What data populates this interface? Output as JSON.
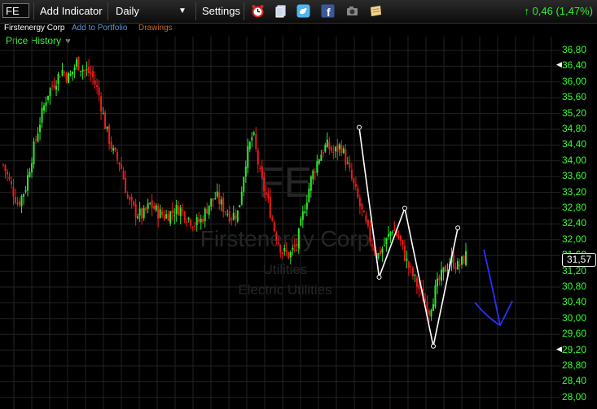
{
  "toolbar": {
    "ticker": "FE",
    "add_indicator": "Add Indicator",
    "interval": "Daily",
    "settings": "Settings",
    "change": "0,46 (1,47%)"
  },
  "subbar": {
    "company": "Firstenergy Corp",
    "add_portfolio": "Add to Portfolio",
    "drawings": "Drawings"
  },
  "panel": {
    "label": "Price History"
  },
  "watermark": {
    "ticker": "FE",
    "company": "Firstenergy Corp",
    "sector": "Utilities",
    "industry": "Electric Utilities"
  },
  "chart_data": {
    "type": "candlestick",
    "y_ticks": [
      "36,80",
      "36,40",
      "36,00",
      "35,60",
      "35,20",
      "34,80",
      "34,40",
      "34,00",
      "33,60",
      "33,20",
      "32,80",
      "32,40",
      "32,00",
      "31,60",
      "31,20",
      "30,80",
      "30,40",
      "30,00",
      "29,60",
      "29,20",
      "28,80",
      "28,40",
      "28,00"
    ],
    "ylim": [
      28.0,
      36.8
    ],
    "last_price": "31,57",
    "price_path": [
      33.9,
      33.4,
      32.9,
      33.3,
      34.2,
      35.0,
      35.7,
      36.0,
      36.3,
      36.1,
      36.5,
      36.3,
      36.2,
      35.7,
      34.8,
      34.2,
      33.9,
      33.0,
      32.7,
      32.6,
      32.9,
      32.7,
      32.6,
      32.7,
      32.8,
      32.6,
      32.4,
      32.5,
      32.9,
      33.1,
      32.8,
      32.6,
      32.7,
      34.0,
      34.7,
      33.6,
      33.0,
      32.2,
      31.7,
      31.6,
      31.9,
      32.8,
      33.6,
      34.1,
      34.4,
      34.2,
      34.4,
      33.8,
      33.2,
      32.6,
      32.0,
      31.6,
      31.9,
      32.3,
      32.0,
      31.4,
      31.0,
      30.6,
      30.2,
      30.8,
      31.2,
      31.5,
      31.3,
      31.6
    ],
    "pattern_points": [
      {
        "x": 20,
        "price": 34.85
      },
      {
        "x": 55,
        "price": 31.05
      },
      {
        "x": 100,
        "price": 32.8
      },
      {
        "x": 150,
        "price": 29.3
      },
      {
        "x": 193,
        "price": 32.3
      }
    ],
    "annotation": "blue down-arrow forecast",
    "grid": true
  }
}
